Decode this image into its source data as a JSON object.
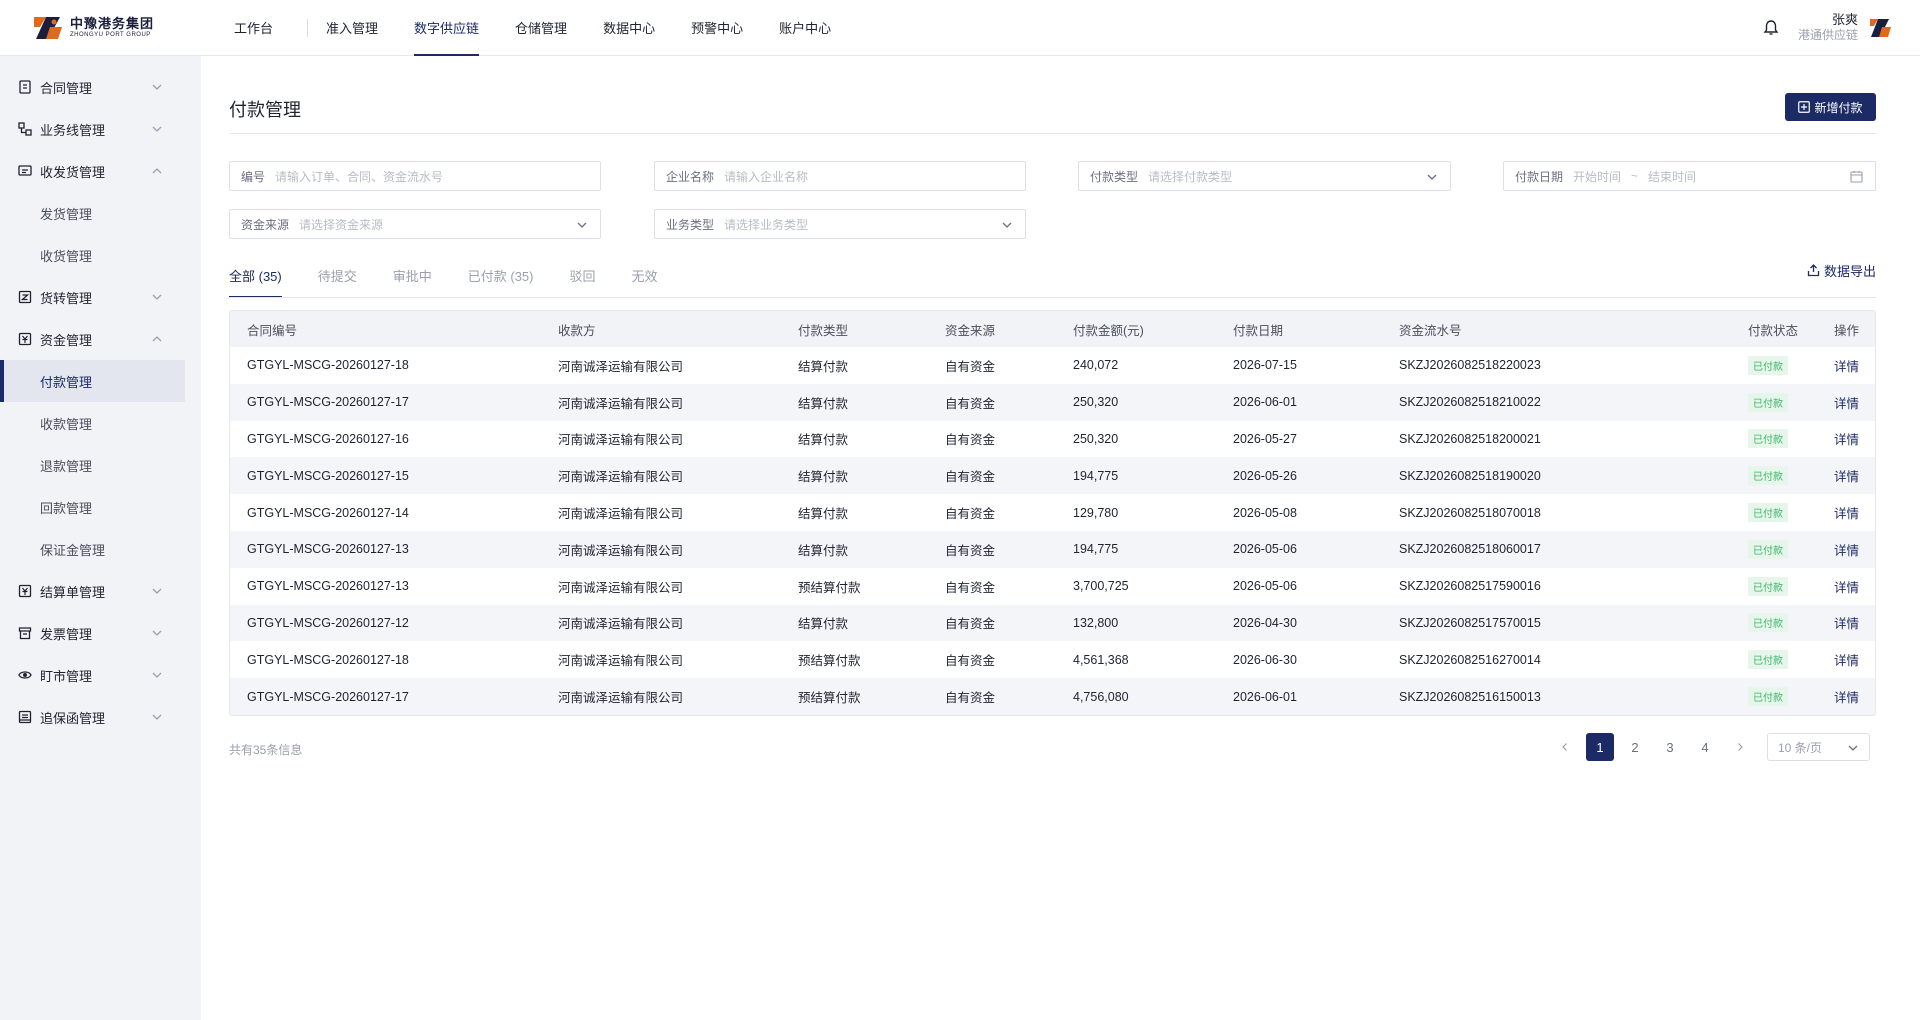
{
  "header": {
    "logo_cn": "中豫港务集团",
    "logo_en": "ZHONGYU PORT GROUP",
    "nav": [
      {
        "label": "工作台"
      },
      {
        "label": "准入管理"
      },
      {
        "label": "数字供应链"
      },
      {
        "label": "仓储管理"
      },
      {
        "label": "数据中心"
      },
      {
        "label": "预警中心"
      },
      {
        "label": "账户中心"
      }
    ],
    "active_nav": "数字供应链",
    "user_name": "张爽",
    "user_org": "港通供应链"
  },
  "sidebar": {
    "items": [
      {
        "label": "合同管理",
        "icon": "contract-icon"
      },
      {
        "label": "业务线管理",
        "icon": "business-line-icon"
      },
      {
        "label": "收发货管理",
        "icon": "shipping-icon",
        "expanded": true,
        "children": [
          "发货管理",
          "收货管理"
        ]
      },
      {
        "label": "货转管理",
        "icon": "cargo-transfer-icon"
      },
      {
        "label": "资金管理",
        "icon": "fund-icon",
        "expanded": true,
        "children": [
          "付款管理",
          "收款管理",
          "退款管理",
          "回款管理",
          "保证金管理"
        ]
      },
      {
        "label": "结算单管理",
        "icon": "settlement-icon"
      },
      {
        "label": "发票管理",
        "icon": "invoice-icon"
      },
      {
        "label": "盯市管理",
        "icon": "eye-icon"
      },
      {
        "label": "追保函管理",
        "icon": "guarantee-icon"
      }
    ],
    "active_sub": "付款管理"
  },
  "page": {
    "title": "付款管理",
    "add_button": "新增付款",
    "export_label": "数据导出"
  },
  "filters": {
    "code": {
      "label": "编号",
      "placeholder": "请输入订单、合同、资金流水号"
    },
    "company": {
      "label": "企业名称",
      "placeholder": "请输入企业名称"
    },
    "pay_type": {
      "label": "付款类型",
      "placeholder": "请选择付款类型"
    },
    "pay_date": {
      "label": "付款日期",
      "start": "开始时间",
      "sep": "~",
      "end": "结束时间"
    },
    "fund_source": {
      "label": "资金来源",
      "placeholder": "请选择资金来源"
    },
    "biz_type": {
      "label": "业务类型",
      "placeholder": "请选择业务类型"
    }
  },
  "tabs": [
    {
      "label": "全部 (35)",
      "active": true
    },
    {
      "label": "待提交"
    },
    {
      "label": "审批中"
    },
    {
      "label": "已付款 (35)"
    },
    {
      "label": "驳回"
    },
    {
      "label": "无效"
    }
  ],
  "table": {
    "columns": [
      "合同编号",
      "收款方",
      "付款类型",
      "资金来源",
      "付款金额(元)",
      "付款日期",
      "资金流水号",
      "付款状态",
      "操作"
    ],
    "rows": [
      [
        "GTGYL-MSCG-20260127-18",
        "河南诚泽运输有限公司",
        "结算付款",
        "自有资金",
        "240,072",
        "2026-07-15",
        "SKZJ2026082518220023",
        "已付款",
        "详情"
      ],
      [
        "GTGYL-MSCG-20260127-17",
        "河南诚泽运输有限公司",
        "结算付款",
        "自有资金",
        "250,320",
        "2026-06-01",
        "SKZJ2026082518210022",
        "已付款",
        "详情"
      ],
      [
        "GTGYL-MSCG-20260127-16",
        "河南诚泽运输有限公司",
        "结算付款",
        "自有资金",
        "250,320",
        "2026-05-27",
        "SKZJ2026082518200021",
        "已付款",
        "详情"
      ],
      [
        "GTGYL-MSCG-20260127-15",
        "河南诚泽运输有限公司",
        "结算付款",
        "自有资金",
        "194,775",
        "2026-05-26",
        "SKZJ2026082518190020",
        "已付款",
        "详情"
      ],
      [
        "GTGYL-MSCG-20260127-14",
        "河南诚泽运输有限公司",
        "结算付款",
        "自有资金",
        "129,780",
        "2026-05-08",
        "SKZJ2026082518070018",
        "已付款",
        "详情"
      ],
      [
        "GTGYL-MSCG-20260127-13",
        "河南诚泽运输有限公司",
        "结算付款",
        "自有资金",
        "194,775",
        "2026-05-06",
        "SKZJ2026082518060017",
        "已付款",
        "详情"
      ],
      [
        "GTGYL-MSCG-20260127-13",
        "河南诚泽运输有限公司",
        "预结算付款",
        "自有资金",
        "3,700,725",
        "2026-05-06",
        "SKZJ2026082517590016",
        "已付款",
        "详情"
      ],
      [
        "GTGYL-MSCG-20260127-12",
        "河南诚泽运输有限公司",
        "结算付款",
        "自有资金",
        "132,800",
        "2026-04-30",
        "SKZJ2026082517570015",
        "已付款",
        "详情"
      ],
      [
        "GTGYL-MSCG-20260127-18",
        "河南诚泽运输有限公司",
        "预结算付款",
        "自有资金",
        "4,561,368",
        "2026-06-30",
        "SKZJ2026082516270014",
        "已付款",
        "详情"
      ],
      [
        "GTGYL-MSCG-20260127-17",
        "河南诚泽运输有限公司",
        "预结算付款",
        "自有资金",
        "4,756,080",
        "2026-06-01",
        "SKZJ2026082516150013",
        "已付款",
        "详情"
      ]
    ]
  },
  "footer": {
    "total_text": "共有35条信息",
    "pages": [
      "1",
      "2",
      "3",
      "4"
    ],
    "current_page": "1",
    "page_size": "10 条/页"
  },
  "colors": {
    "primary": "#1c2a66",
    "success_bg": "#e6f6ea",
    "success_text": "#3bb56a"
  }
}
